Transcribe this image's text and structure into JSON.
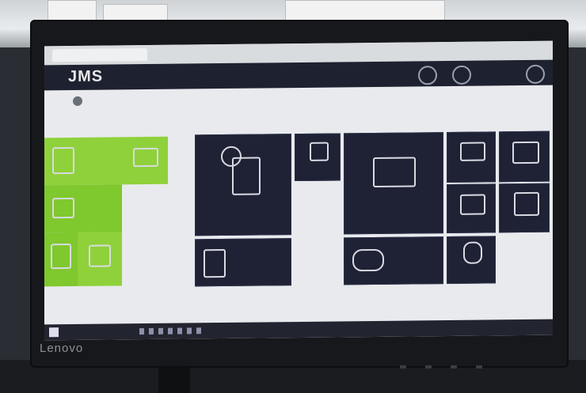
{
  "app": {
    "logo": "JMS"
  },
  "monitor": {
    "brand": "Lenovo"
  }
}
